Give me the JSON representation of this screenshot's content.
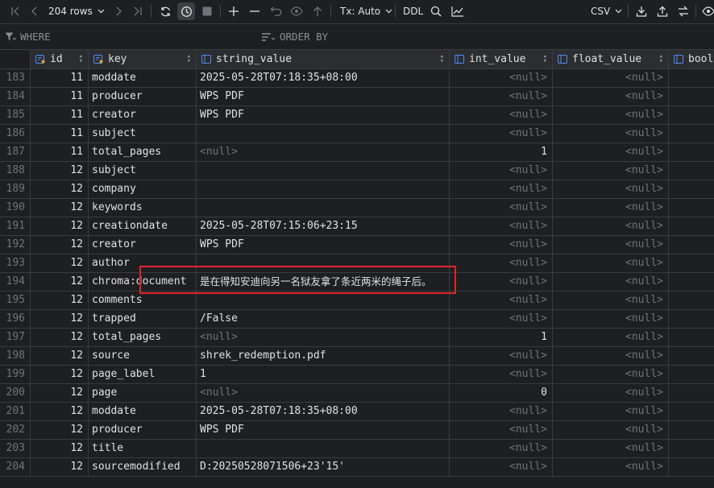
{
  "toolbar": {
    "rows_label": "204 rows",
    "tx_label": "Tx: Auto",
    "ddl_label": "DDL",
    "export_format": "CSV"
  },
  "filter": {
    "where_label": "WHERE",
    "orderby_label": "ORDER BY"
  },
  "columns": [
    {
      "label": "id"
    },
    {
      "label": "key"
    },
    {
      "label": "string_value"
    },
    {
      "label": "int_value"
    },
    {
      "label": "float_value"
    },
    {
      "label": "bool"
    }
  ],
  "null_text": "<null>",
  "rows": [
    {
      "num": "183",
      "id": "11",
      "key": "moddate",
      "str": "2025-05-28T07:18:35+08:00",
      "int": "<null>",
      "flt": "<null>"
    },
    {
      "num": "184",
      "id": "11",
      "key": "producer",
      "str": "WPS PDF",
      "int": "<null>",
      "flt": "<null>"
    },
    {
      "num": "185",
      "id": "11",
      "key": "creator",
      "str": "WPS PDF",
      "int": "<null>",
      "flt": "<null>"
    },
    {
      "num": "186",
      "id": "11",
      "key": "subject",
      "str": "",
      "int": "<null>",
      "flt": "<null>"
    },
    {
      "num": "187",
      "id": "11",
      "key": "total_pages",
      "str": "<null>",
      "int": "1",
      "flt": "<null>"
    },
    {
      "num": "188",
      "id": "12",
      "key": "subject",
      "str": "",
      "int": "<null>",
      "flt": "<null>"
    },
    {
      "num": "189",
      "id": "12",
      "key": "company",
      "str": "",
      "int": "<null>",
      "flt": "<null>"
    },
    {
      "num": "190",
      "id": "12",
      "key": "keywords",
      "str": "",
      "int": "<null>",
      "flt": "<null>"
    },
    {
      "num": "191",
      "id": "12",
      "key": "creationdate",
      "str": "2025-05-28T07:15:06+23:15",
      "int": "<null>",
      "flt": "<null>"
    },
    {
      "num": "192",
      "id": "12",
      "key": "creator",
      "str": "WPS PDF",
      "int": "<null>",
      "flt": "<null>"
    },
    {
      "num": "193",
      "id": "12",
      "key": "author",
      "str": "",
      "int": "<null>",
      "flt": "<null>"
    },
    {
      "num": "194",
      "id": "12",
      "key": "chroma:document",
      "str": "是在得知安迪向另一名狱友拿了条近两米的绳子后。",
      "int": "<null>",
      "flt": "<null>"
    },
    {
      "num": "195",
      "id": "12",
      "key": "comments",
      "str": "",
      "int": "<null>",
      "flt": "<null>"
    },
    {
      "num": "196",
      "id": "12",
      "key": "trapped",
      "str": "/False",
      "int": "<null>",
      "flt": "<null>"
    },
    {
      "num": "197",
      "id": "12",
      "key": "total_pages",
      "str": "<null>",
      "int": "1",
      "flt": "<null>"
    },
    {
      "num": "198",
      "id": "12",
      "key": "source",
      "str": "shrek_redemption.pdf",
      "int": "<null>",
      "flt": "<null>"
    },
    {
      "num": "199",
      "id": "12",
      "key": "page_label",
      "str": "1",
      "int": "<null>",
      "flt": "<null>"
    },
    {
      "num": "200",
      "id": "12",
      "key": "page",
      "str": "<null>",
      "int": "0",
      "flt": "<null>"
    },
    {
      "num": "201",
      "id": "12",
      "key": "moddate",
      "str": "2025-05-28T07:18:35+08:00",
      "int": "<null>",
      "flt": "<null>"
    },
    {
      "num": "202",
      "id": "12",
      "key": "producer",
      "str": "WPS PDF",
      "int": "<null>",
      "flt": "<null>"
    },
    {
      "num": "203",
      "id": "12",
      "key": "title",
      "str": "",
      "int": "<null>",
      "flt": "<null>"
    },
    {
      "num": "204",
      "id": "12",
      "key": "sourcemodified",
      "str": "D:20250528071506+23'15'",
      "int": "<null>",
      "flt": "<null>"
    }
  ],
  "colors": {
    "background": "#1e1f22",
    "header_bg": "#2b2d30",
    "grid": "#393b40",
    "null_text": "#6f737a",
    "highlight": "#e0242a"
  }
}
